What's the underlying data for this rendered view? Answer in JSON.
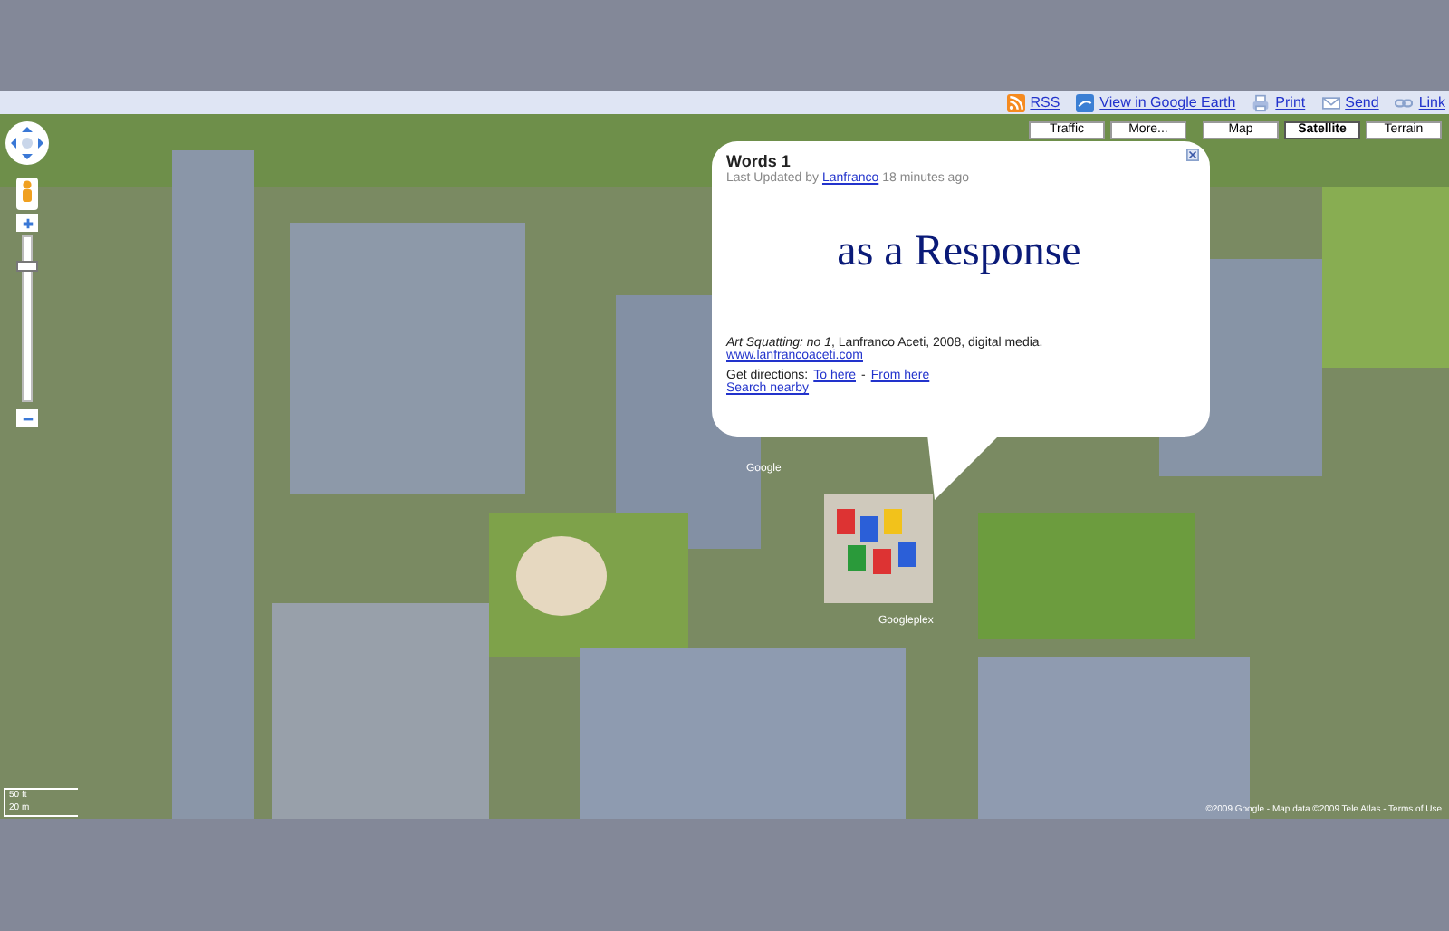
{
  "toolbar": {
    "links": [
      {
        "label": "RSS",
        "kind": "rss"
      },
      {
        "label": "View in Google Earth",
        "kind": "earth"
      },
      {
        "label": "Print",
        "kind": "print"
      },
      {
        "label": "Send",
        "kind": "send"
      },
      {
        "label": "Link",
        "kind": "link"
      }
    ]
  },
  "map_type_buttons": [
    {
      "label": "Traffic",
      "selected": false
    },
    {
      "label": "More...",
      "selected": false
    },
    {
      "label": "Map",
      "selected": false
    },
    {
      "label": "Satellite",
      "selected": true
    },
    {
      "label": "Terrain",
      "selected": false
    }
  ],
  "zoom_slider": {
    "level": 0.85
  },
  "map_labels": [
    "Google",
    "Googleplex"
  ],
  "info_window": {
    "title": "Words 1",
    "updated_prefix": "Last Updated by",
    "author": "Lanfranco",
    "updated_suffix": "18 minutes ago",
    "headline": "as a Response",
    "caption": "*Art Squatting: no 1*, Lanfranco Aceti, 2008, digital media.",
    "website": "www.lanfrancoaceti.com",
    "directions_label": "Get directions:",
    "to_here": "To here",
    "separator": "-",
    "from_here": "From here",
    "search_nearby": "Search nearby"
  },
  "scale": [
    "50 ft",
    "20 m"
  ],
  "attribution": "©2009 Google - Map data ©2009 Tele Atlas - Terms of Use"
}
